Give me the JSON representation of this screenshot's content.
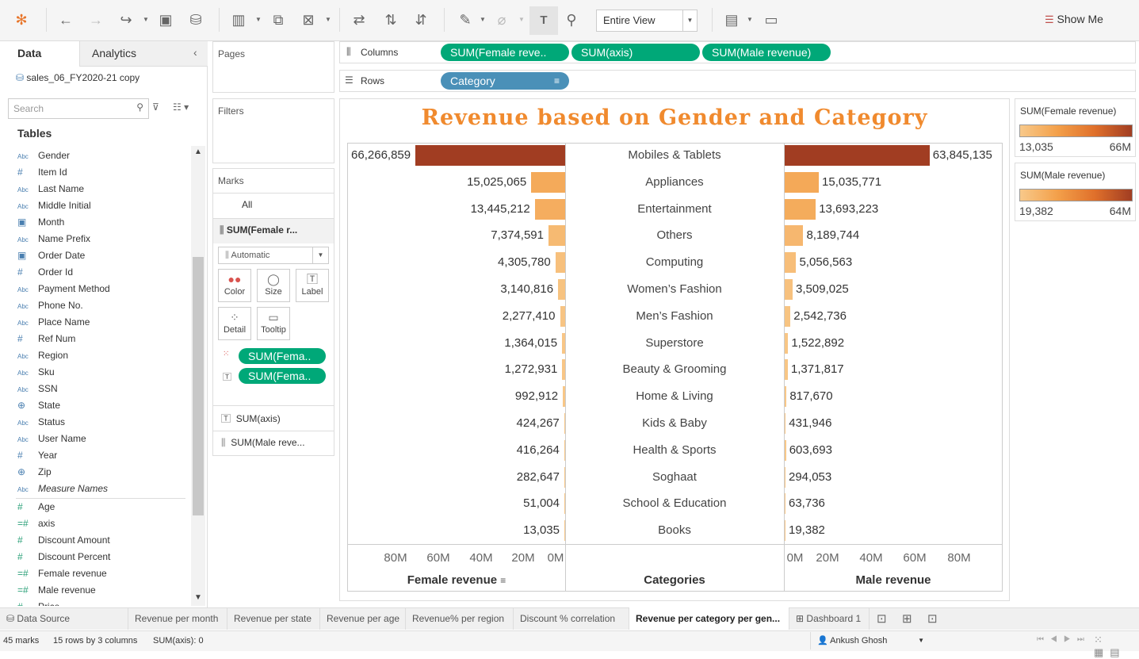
{
  "toolbar": {
    "view_select": "Entire View",
    "show_me": "Show Me"
  },
  "data_pane": {
    "tab_data": "Data",
    "tab_analytics": "Analytics",
    "datasource": "sales_06_FY2020-21 copy",
    "search_placeholder": "Search",
    "tables_heading": "Tables",
    "dims": [
      {
        "icon": "Abc",
        "label": "Gender"
      },
      {
        "icon": "#",
        "label": "Item Id"
      },
      {
        "icon": "Abc",
        "label": "Last Name"
      },
      {
        "icon": "Abc",
        "label": "Middle Initial"
      },
      {
        "icon": "cal",
        "label": "Month"
      },
      {
        "icon": "Abc",
        "label": "Name Prefix"
      },
      {
        "icon": "cal",
        "label": "Order Date"
      },
      {
        "icon": "#",
        "label": "Order Id"
      },
      {
        "icon": "Abc",
        "label": "Payment Method"
      },
      {
        "icon": "Abc",
        "label": "Phone No."
      },
      {
        "icon": "Abc",
        "label": "Place Name"
      },
      {
        "icon": "#",
        "label": "Ref Num"
      },
      {
        "icon": "Abc",
        "label": "Region"
      },
      {
        "icon": "Abc",
        "label": "Sku"
      },
      {
        "icon": "Abc",
        "label": "SSN"
      },
      {
        "icon": "globe",
        "label": "State"
      },
      {
        "icon": "Abc",
        "label": "Status"
      },
      {
        "icon": "Abc",
        "label": "User Name"
      },
      {
        "icon": "#",
        "label": "Year"
      },
      {
        "icon": "globe",
        "label": "Zip"
      },
      {
        "icon": "Abc",
        "label": "Measure Names"
      }
    ],
    "measures": [
      {
        "icon": "#",
        "label": "Age"
      },
      {
        "icon": "=#",
        "label": "axis"
      },
      {
        "icon": "#",
        "label": "Discount Amount"
      },
      {
        "icon": "#",
        "label": "Discount Percent"
      },
      {
        "icon": "=#",
        "label": "Female revenue"
      },
      {
        "icon": "=#",
        "label": "Male revenue"
      },
      {
        "icon": "#",
        "label": "Price"
      }
    ]
  },
  "cards": {
    "pages": "Pages",
    "filters": "Filters",
    "marks": "Marks",
    "all": "All",
    "sumfemale": "SUM(Female r...",
    "mark_type": "Automatic",
    "color": "Color",
    "size": "Size",
    "label": "Label",
    "detail": "Detail",
    "tooltip": "Tooltip",
    "pill1": "SUM(Fema..",
    "pill2": "SUM(Fema..",
    "sumaxis": "SUM(axis)",
    "summale": "SUM(Male reve..."
  },
  "shelves": {
    "columns_label": "Columns",
    "rows_label": "Rows",
    "col_pills": [
      "SUM(Female reve..",
      "SUM(axis)",
      "SUM(Male revenue)"
    ],
    "row_pill": "Category"
  },
  "legends": [
    {
      "title": "SUM(Female revenue)",
      "min": "13,035",
      "max": "66M"
    },
    {
      "title": "SUM(Male revenue)",
      "min": "19,382",
      "max": "64M"
    }
  ],
  "chart_data": {
    "type": "bar",
    "title": "Revenue based on Gender and Category",
    "categories": [
      "Mobiles & Tablets",
      "Appliances",
      "Entertainment",
      "Others",
      "Computing",
      "Women’s Fashion",
      "Men’s Fashion",
      "Superstore",
      "Beauty & Grooming",
      "Home & Living",
      "Kids & Baby",
      "Health & Sports",
      "Soghaat",
      "School & Education",
      "Books"
    ],
    "series": [
      {
        "name": "Female revenue",
        "values": [
          66266859,
          15025065,
          13445212,
          7374591,
          4305780,
          3140816,
          2277410,
          1364015,
          1272931,
          992912,
          424267,
          416264,
          282647,
          51004,
          13035
        ],
        "labels": [
          "66,266,859",
          "15,025,065",
          "13,445,212",
          "7,374,591",
          "4,305,780",
          "3,140,816",
          "2,277,410",
          "1,364,015",
          "1,272,931",
          "992,912",
          "424,267",
          "416,264",
          "282,647",
          "51,004",
          "13,035"
        ]
      },
      {
        "name": "Male revenue",
        "values": [
          63845135,
          15035771,
          13693223,
          8189744,
          5056563,
          3509025,
          2542736,
          1522892,
          1371817,
          817670,
          431946,
          603693,
          294053,
          63736,
          19382
        ],
        "labels": [
          "63,845,135",
          "15,035,771",
          "13,693,223",
          "8,189,744",
          "5,056,563",
          "3,509,025",
          "2,542,736",
          "1,522,892",
          "1,371,817",
          "817,670",
          "431,946",
          "603,693",
          "294,053",
          "63,736",
          "19,382"
        ]
      }
    ],
    "female_ticks": [
      "80M",
      "60M",
      "40M",
      "20M",
      "0M"
    ],
    "male_ticks": [
      "0M",
      "20M",
      "40M",
      "60M",
      "80M"
    ],
    "xlabel_left": "Female revenue",
    "xlabel_mid": "Categories",
    "xlabel_right": "Male revenue",
    "xlim": [
      0,
      80000000
    ],
    "colors": {
      "low": "#f8c98a",
      "high": "#a13d22"
    }
  },
  "bottom_tabs": {
    "datasource": "Data Source",
    "sheets": [
      "Revenue per month",
      "Revenue per state",
      "Revenue per age",
      "Revenue% per region",
      "Discount % correlation",
      "Revenue per category per gen...",
      "Dashboard 1"
    ]
  },
  "status": {
    "marks": "45 marks",
    "rows": "15 rows by 3 columns",
    "sum": "SUM(axis): 0",
    "user": "Ankush Ghosh"
  }
}
